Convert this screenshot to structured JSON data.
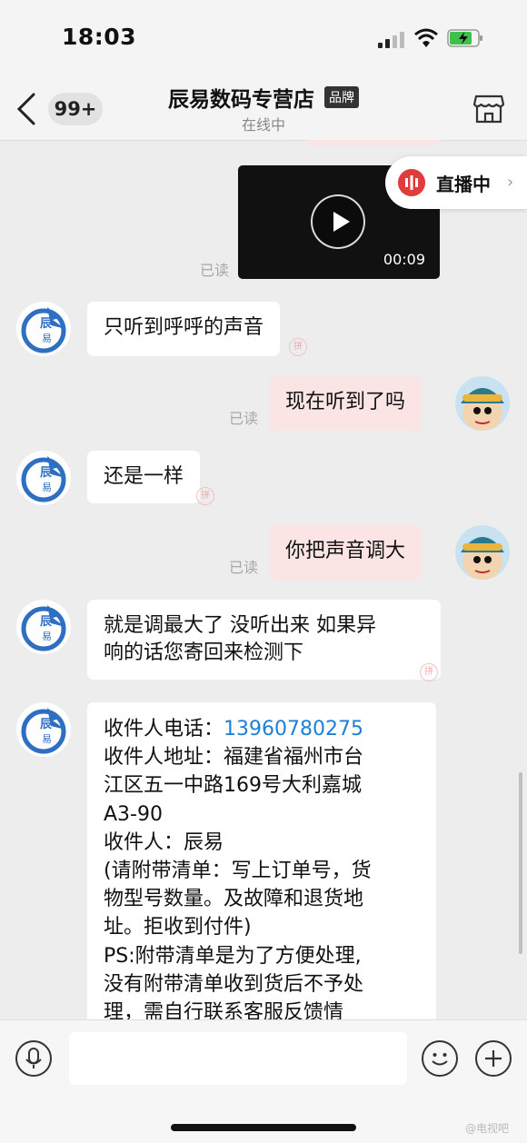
{
  "status_bar": {
    "time": "18:03"
  },
  "header": {
    "unread_count": "99+",
    "shop_name": "辰易数码专营店",
    "brand_tag": "品牌",
    "online_status": "在线中"
  },
  "live": {
    "label": "直播中"
  },
  "video": {
    "duration": "00:09"
  },
  "read_label": "已读",
  "messages": [
    {
      "side": "left",
      "text": "只听到呼呼的声音"
    },
    {
      "side": "right",
      "text": "现在听到了吗"
    },
    {
      "side": "left",
      "text": "还是一样"
    },
    {
      "side": "right",
      "text": "你把声音调大"
    },
    {
      "side": "left",
      "lines": [
        "就是调最大了  没听出来 如果异",
        "响的话您寄回来检测下"
      ]
    },
    {
      "side": "left",
      "phone_label": "收件人电话：",
      "phone": "13960780275",
      "lines": [
        "收件人地址：福建省福州市台",
        "江区五一中路169号大利嘉城",
        "A3-90",
        "收件人：辰易",
        "(请附带清单：写上订单号，货",
        "物型号数量。及故障和退货地",
        "址。拒收到付件)",
        "PS:附带清单是为了方便处理,",
        "没有附带清单收到货后不予处",
        "理，需自行联系客服反馈情"
      ]
    }
  ],
  "avatar_text": "辰易",
  "corner_mark": "拼",
  "watermark": "@电视吧",
  "colors": {
    "phone_link": "#1e7ed8",
    "right_bubble": "#fbe4e4",
    "live_red": "#e23b3b"
  }
}
